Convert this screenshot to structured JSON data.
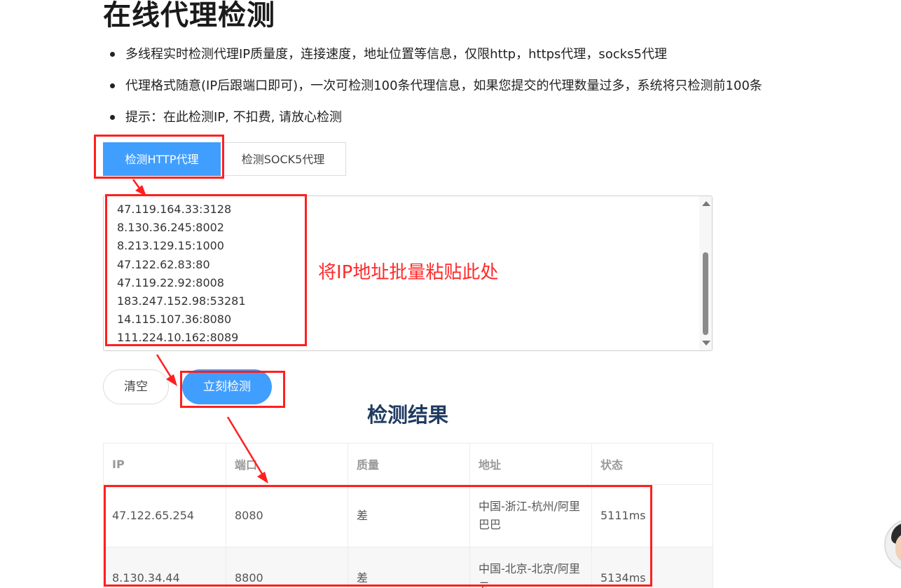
{
  "page": {
    "title": "在线代理检测",
    "bullets": [
      "多线程实时检测代理IP质量度，连接速度，地址位置等信息，仅限http，https代理，socks5代理",
      "代理格式随意(IP后跟端口即可)，一次可检测100条代理信息，如果您提交的代理数量过多，系统将只检测前100条",
      "提示：在此检测IP, 不扣费, 请放心检测"
    ]
  },
  "tabs": [
    {
      "label": "检测HTTP代理",
      "active": true
    },
    {
      "label": "检测SOCK5代理",
      "active": false
    }
  ],
  "proxy_input": {
    "lines": [
      "47.119.164.33:3128",
      "8.130.36.245:8002",
      "8.213.129.15:1000",
      "47.122.62.83:80",
      "47.119.22.92:8008",
      "183.247.152.98:53281",
      "14.115.107.36:8080",
      "111.224.10.162:8089"
    ]
  },
  "annotation": {
    "text": "将IP地址批量粘贴此处",
    "color": "#ff2a2a"
  },
  "buttons": {
    "clear": "清空",
    "check": "立刻检测"
  },
  "results": {
    "title": "检测结果",
    "headers": [
      "IP",
      "端口",
      "质量",
      "地址",
      "状态"
    ],
    "rows": [
      [
        "47.122.65.254",
        "8080",
        "差",
        "中国-浙江-杭州/阿里巴巴",
        "5111ms"
      ],
      [
        "8.130.34.44",
        "8800",
        "差",
        "中国-北京-北京/阿里云",
        "5134ms"
      ]
    ]
  },
  "colors": {
    "primary": "#409eff",
    "annotation_red": "#ff1f1f",
    "result_title": "#1f3a5f"
  },
  "icons": [
    "scroll-up-arrow-icon",
    "scroll-down-arrow-icon",
    "avatar"
  ]
}
